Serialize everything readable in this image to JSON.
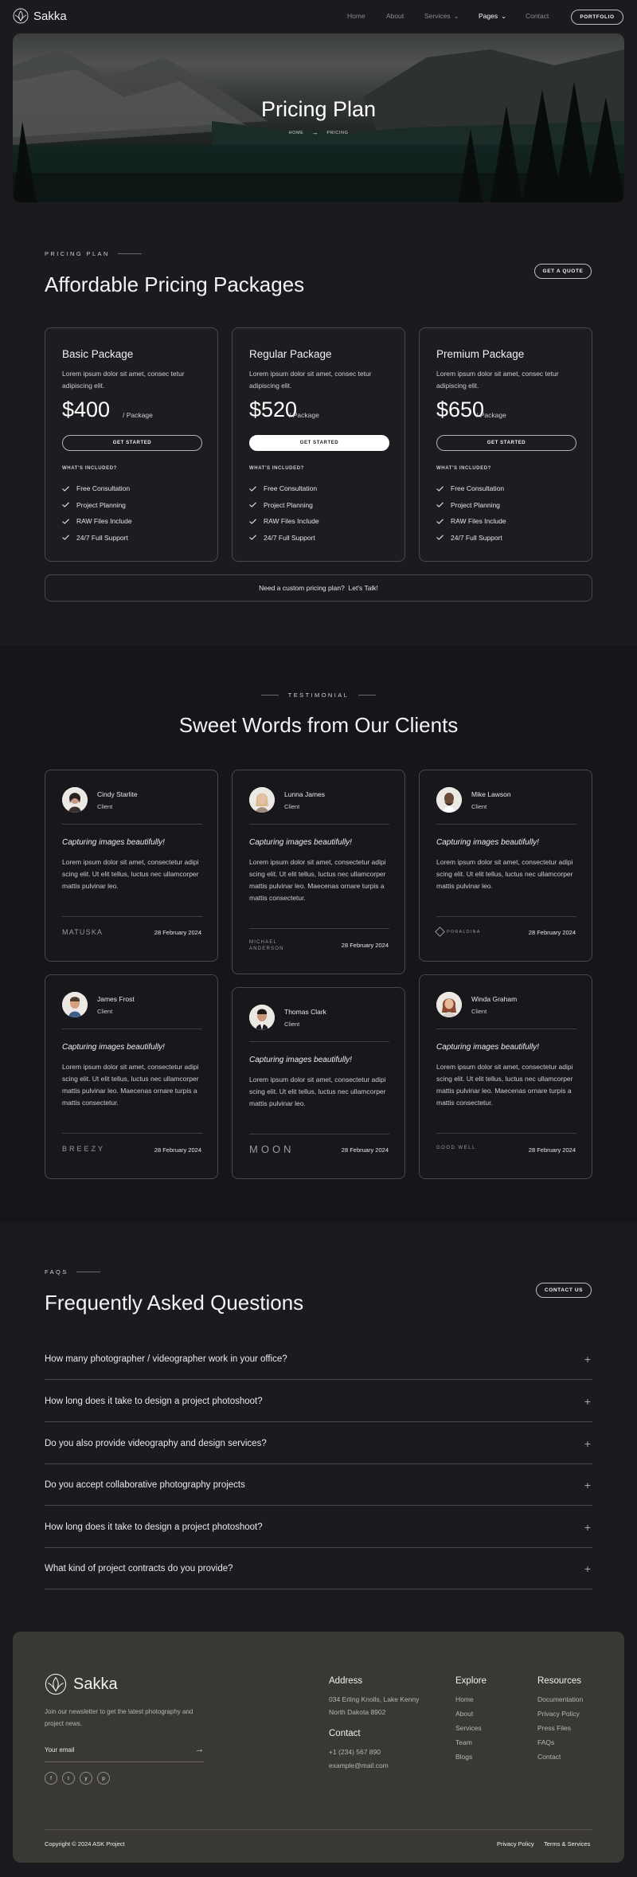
{
  "header": {
    "brand": "Sakka",
    "nav": [
      "Home",
      "About",
      "Services",
      "Pages",
      "Contact"
    ],
    "active": "Pages",
    "portfolio_label": "PORTFOLIO"
  },
  "hero": {
    "title": "Pricing Plan",
    "crumb_home": "HOME",
    "crumb_current": "PRICING"
  },
  "pricing": {
    "label": "PRICING PLAN",
    "title": "Affordable Pricing Packages",
    "quote_button": "GET A QUOTE",
    "cards": [
      {
        "name": "Basic Package",
        "desc": "Lorem ipsum dolor sit amet, consec tetur adipiscing elit.",
        "price": "$400",
        "per": "/ Package",
        "cta": "GET STARTED",
        "included_label": "WHAT'S INCLUDED?",
        "features": [
          "Free Consultation",
          "Project Planning",
          "RAW Files Include",
          "24/7 Full Support"
        ]
      },
      {
        "name": "Regular Package",
        "desc": "Lorem ipsum dolor sit amet, consec tetur adipiscing elit.",
        "price": "$520",
        "per": "/ Package",
        "cta": "GET STARTED",
        "included_label": "WHAT'S INCLUDED?",
        "features": [
          "Free Consultation",
          "Project Planning",
          "RAW Files Include",
          "24/7 Full Support"
        ]
      },
      {
        "name": "Premium Package",
        "desc": "Lorem ipsum dolor sit amet, consec tetur adipiscing elit.",
        "price": "$650",
        "per": "/ Package",
        "cta": "GET STARTED",
        "included_label": "WHAT'S INCLUDED?",
        "features": [
          "Free Consultation",
          "Project Planning",
          "RAW Files Include",
          "24/7 Full Support"
        ]
      }
    ],
    "custom_text": "Need a custom pricing plan?",
    "custom_link": "Let's Talk!"
  },
  "testimonials": {
    "label": "TESTIMONIAL",
    "title": "Sweet Words from Our Clients",
    "items": [
      {
        "name": "Cindy Starlite",
        "role": "Client",
        "quote": "Capturing images beautifully!",
        "body": "Lorem ipsum dolor sit amet, consectetur adipi scing elit. Ut elit tellus, luctus nec ullamcorper mattis pulvinar leo.",
        "brand": "MATUSKA",
        "date": "28 February 2024"
      },
      {
        "name": "Lunna James",
        "role": "Client",
        "quote": "Capturing images beautifully!",
        "body": "Lorem ipsum dolor sit amet, consectetur adipi scing elit. Ut elit tellus, luctus nec ullamcorper mattis pulvinar leo. Maecenas ornare turpis a mattis consectetur.",
        "brand": "MICHAEL ANDERSON",
        "date": "28 February 2024"
      },
      {
        "name": "Mike Lawson",
        "role": "Client",
        "quote": "Capturing images beautifully!",
        "body": "Lorem ipsum dolor sit amet, consectetur adipi scing elit. Ut elit tellus, luctus nec ullamcorper mattis pulvinar leo.",
        "brand": "PORALDINA",
        "date": "28 February 2024"
      },
      {
        "name": "James Frost",
        "role": "Client",
        "quote": "Capturing images beautifully!",
        "body": "Lorem ipsum dolor sit amet, consectetur adipi scing elit. Ut elit tellus, luctus nec ullamcorper mattis pulvinar leo. Maecenas ornare turpis a mattis consectetur.",
        "brand": "BREEZY",
        "date": "28 February 2024"
      },
      {
        "name": "Thomas Clark",
        "role": "Client",
        "quote": "Capturing images beautifully!",
        "body": "Lorem ipsum dolor sit amet, consectetur adipi scing elit. Ut elit tellus, luctus nec ullamcorper mattis pulvinar leo.",
        "brand": "MOON",
        "date": "28 February 2024"
      },
      {
        "name": "Winda Graham",
        "role": "Client",
        "quote": "Capturing images beautifully!",
        "body": "Lorem ipsum dolor sit amet, consectetur adipi scing elit. Ut elit tellus, luctus nec ullamcorper mattis pulvinar leo. Maecenas ornare turpis a mattis consectetur.",
        "brand": "GOOD WELL",
        "date": "28 February 2024"
      }
    ]
  },
  "faq": {
    "label": "FAQS",
    "title": "Frequently Asked Questions",
    "contact_button": "CONTACT US",
    "questions": [
      "How many photographer / videographer work in your office?",
      "How long does it take to design a project photoshoot?",
      "Do you also provide videography and design services?",
      "Do you accept collaborative photography projects",
      "How long does it take to design a project photoshoot?",
      "What kind of project contracts do you provide?"
    ]
  },
  "footer": {
    "brand": "Sakka",
    "newsletter": "Join our newsletter to get the latest photography and project news.",
    "email_placeholder": "Your email",
    "social": [
      "f",
      "t",
      "y",
      "p"
    ],
    "address_title": "Address",
    "address_line1": "034 Erling Knolls, Lake Kenny",
    "address_line2": "North Dakota 8902",
    "contact_title": "Contact",
    "phone": "+1 (234) 567 890",
    "email": "example@mail.com",
    "explore_title": "Explore",
    "explore": [
      "Home",
      "About",
      "Services",
      "Team",
      "Blogs"
    ],
    "resources_title": "Resources",
    "resources": [
      "Documentation",
      "Privacy Policy",
      "Press Files",
      "FAQs",
      "Contact"
    ],
    "copyright": "Copyright © 2024 ASK Project",
    "privacy": "Privacy Policy",
    "terms": "Terms & Services"
  }
}
